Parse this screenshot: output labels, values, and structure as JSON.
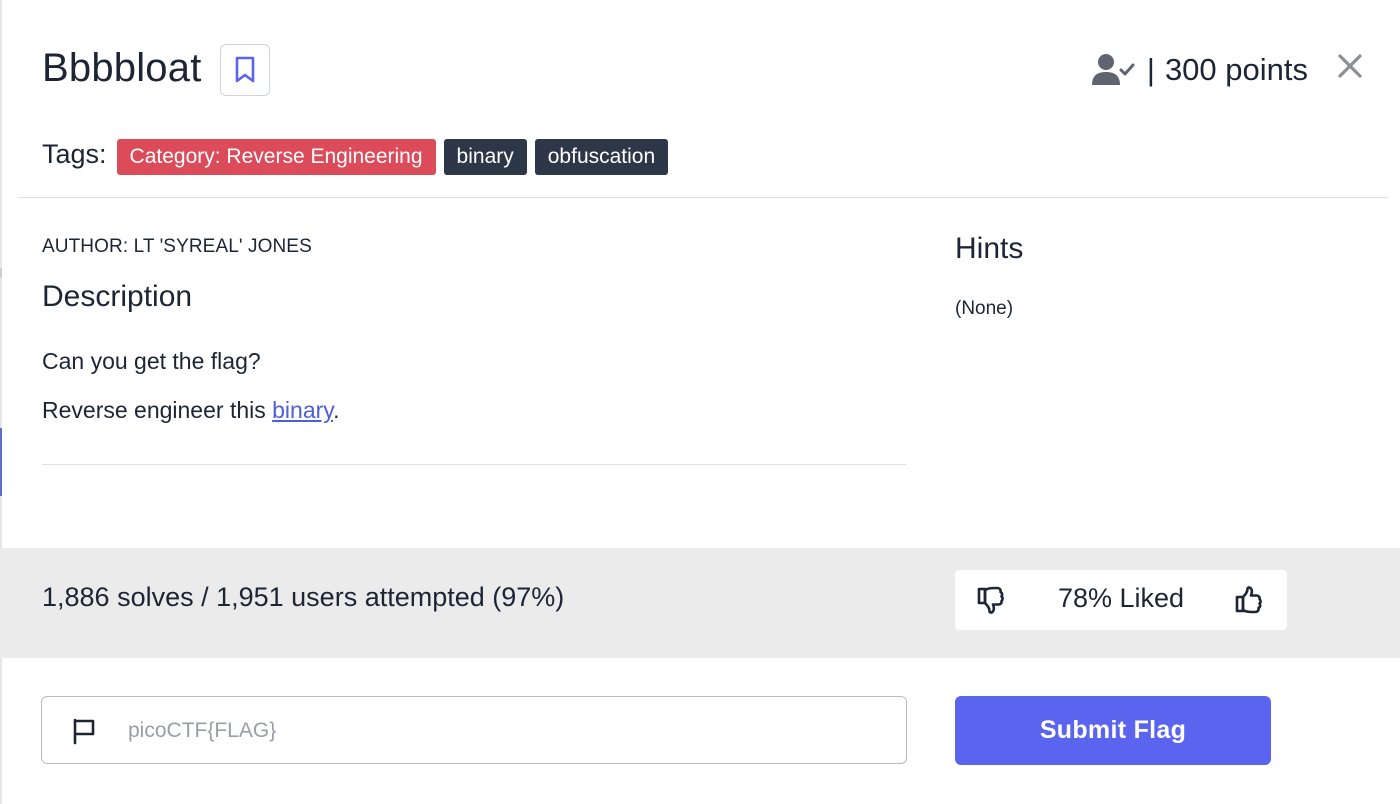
{
  "challenge": {
    "title": "Bbbbloat",
    "points_separator": "|",
    "points_label": "300 points",
    "close_symbol": "✕"
  },
  "tags": {
    "label": "Tags:",
    "items": [
      {
        "text": "Category: Reverse Engineering",
        "color": "#dc4b5a"
      },
      {
        "text": "binary",
        "color": "#2e3748"
      },
      {
        "text": "obfuscation",
        "color": "#2e3748"
      }
    ]
  },
  "details": {
    "author": "AUTHOR: LT 'SYREAL' JONES",
    "description_title": "Description",
    "line1": "Can you get the flag?",
    "line2_prefix": "Reverse engineer this ",
    "line2_link": "binary",
    "line2_suffix": "."
  },
  "hints": {
    "title": "Hints",
    "value": "(None)"
  },
  "stats": {
    "solves_text": "1,886 solves / 1,951 users attempted (97%)",
    "liked_text": "78% Liked"
  },
  "submit": {
    "placeholder": "picoCTF{FLAG}",
    "button_label": "Submit Flag",
    "button_color": "#5a64ee"
  },
  "icons": {
    "bookmark": "bookmark-icon",
    "user_check": "user-check-icon",
    "close": "close-icon",
    "thumbs_down": "thumbs-down-icon",
    "thumbs_up": "thumbs-up-icon",
    "flag": "flag-icon"
  }
}
